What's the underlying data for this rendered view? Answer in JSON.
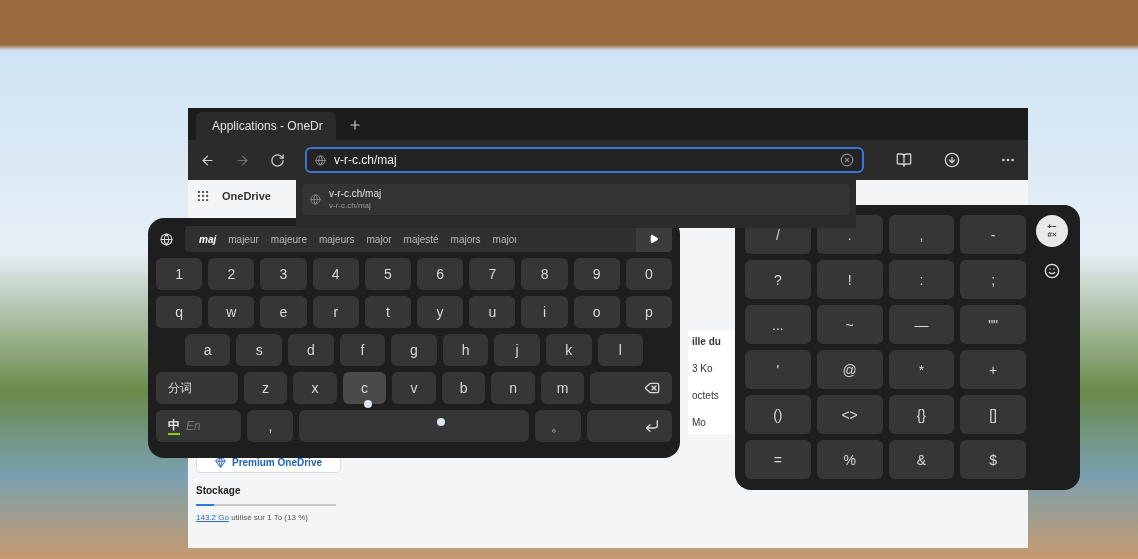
{
  "browser": {
    "tab": {
      "title": "Applications - OneDr",
      "selected": true
    },
    "address": {
      "value": "v-r-c.ch/maj"
    },
    "suggestion": {
      "title": "v-r-c.ch/maj",
      "url": "v-r-c.ch/maj"
    },
    "app_name": "OneDrive",
    "column_texts": [
      "ille du",
      "3 Ko",
      "octets",
      "Mo"
    ],
    "premium_button": "Premium OneDrive",
    "storage": {
      "heading": "Stockage",
      "used": "143.2 Go",
      "detail": "utilisé sur 1 To (13 %)",
      "level": 0.13
    }
  },
  "keyboard": {
    "suggestions": [
      {
        "label": "maj",
        "selected": true
      },
      {
        "label": "majeur",
        "selected": false
      },
      {
        "label": "majeure",
        "selected": false
      },
      {
        "label": "majeurs",
        "selected": false
      },
      {
        "label": "major",
        "selected": false
      },
      {
        "label": "majesté",
        "selected": false
      },
      {
        "label": "majors",
        "selected": false
      },
      {
        "label": "majoı",
        "selected": false
      }
    ],
    "rows": [
      [
        {
          "kind": "char",
          "label": "1"
        },
        {
          "kind": "char",
          "label": "2"
        },
        {
          "kind": "char",
          "label": "3"
        },
        {
          "kind": "char",
          "label": "4"
        },
        {
          "kind": "char",
          "label": "5"
        },
        {
          "kind": "char",
          "label": "6"
        },
        {
          "kind": "char",
          "label": "7"
        },
        {
          "kind": "char",
          "label": "8"
        },
        {
          "kind": "char",
          "label": "9"
        },
        {
          "kind": "char",
          "label": "0"
        }
      ],
      [
        {
          "kind": "char",
          "label": "q"
        },
        {
          "kind": "char",
          "label": "w"
        },
        {
          "kind": "char",
          "label": "e"
        },
        {
          "kind": "char",
          "label": "r"
        },
        {
          "kind": "char",
          "label": "t"
        },
        {
          "kind": "char",
          "label": "y"
        },
        {
          "kind": "char",
          "label": "u"
        },
        {
          "kind": "char",
          "label": "i"
        },
        {
          "kind": "char",
          "label": "o"
        },
        {
          "kind": "char",
          "label": "p"
        }
      ],
      [
        {
          "kind": "gap"
        },
        {
          "kind": "char",
          "label": "a"
        },
        {
          "kind": "char",
          "label": "s"
        },
        {
          "kind": "char",
          "label": "d"
        },
        {
          "kind": "char",
          "label": "f"
        },
        {
          "kind": "char",
          "label": "g"
        },
        {
          "kind": "char",
          "label": "h"
        },
        {
          "kind": "char",
          "label": "j"
        },
        {
          "kind": "char",
          "label": "k"
        },
        {
          "kind": "char",
          "label": "l"
        },
        {
          "kind": "gap"
        }
      ],
      [
        {
          "kind": "wide",
          "label": "分词"
        },
        {
          "kind": "char",
          "label": "z"
        },
        {
          "kind": "char",
          "label": "x"
        },
        {
          "kind": "char",
          "label": "c",
          "pressed": true
        },
        {
          "kind": "char",
          "label": "v"
        },
        {
          "kind": "char",
          "label": "b"
        },
        {
          "kind": "char",
          "label": "n"
        },
        {
          "kind": "char",
          "label": "m"
        },
        {
          "kind": "backspace"
        }
      ],
      [
        {
          "kind": "lang",
          "options": [
            {
              "label": "中",
              "selected": true
            },
            {
              "label": "En",
              "selected": false
            }
          ]
        },
        {
          "kind": "char",
          "label": ","
        },
        {
          "kind": "space"
        },
        {
          "kind": "char",
          "label": "。"
        },
        {
          "kind": "enter"
        }
      ]
    ]
  },
  "symbols": {
    "mode_key": [
      "+−",
      "#×"
    ],
    "rows": [
      [
        "/",
        ".",
        ",",
        "-"
      ],
      [
        "?",
        "!",
        ":",
        ";"
      ],
      [
        "...",
        "~",
        "—",
        "\"\""
      ],
      [
        "'",
        "@",
        "*",
        "+"
      ],
      [
        "()",
        "<>",
        "{}",
        "[]"
      ],
      [
        "=",
        "%",
        "&",
        "$"
      ]
    ]
  }
}
